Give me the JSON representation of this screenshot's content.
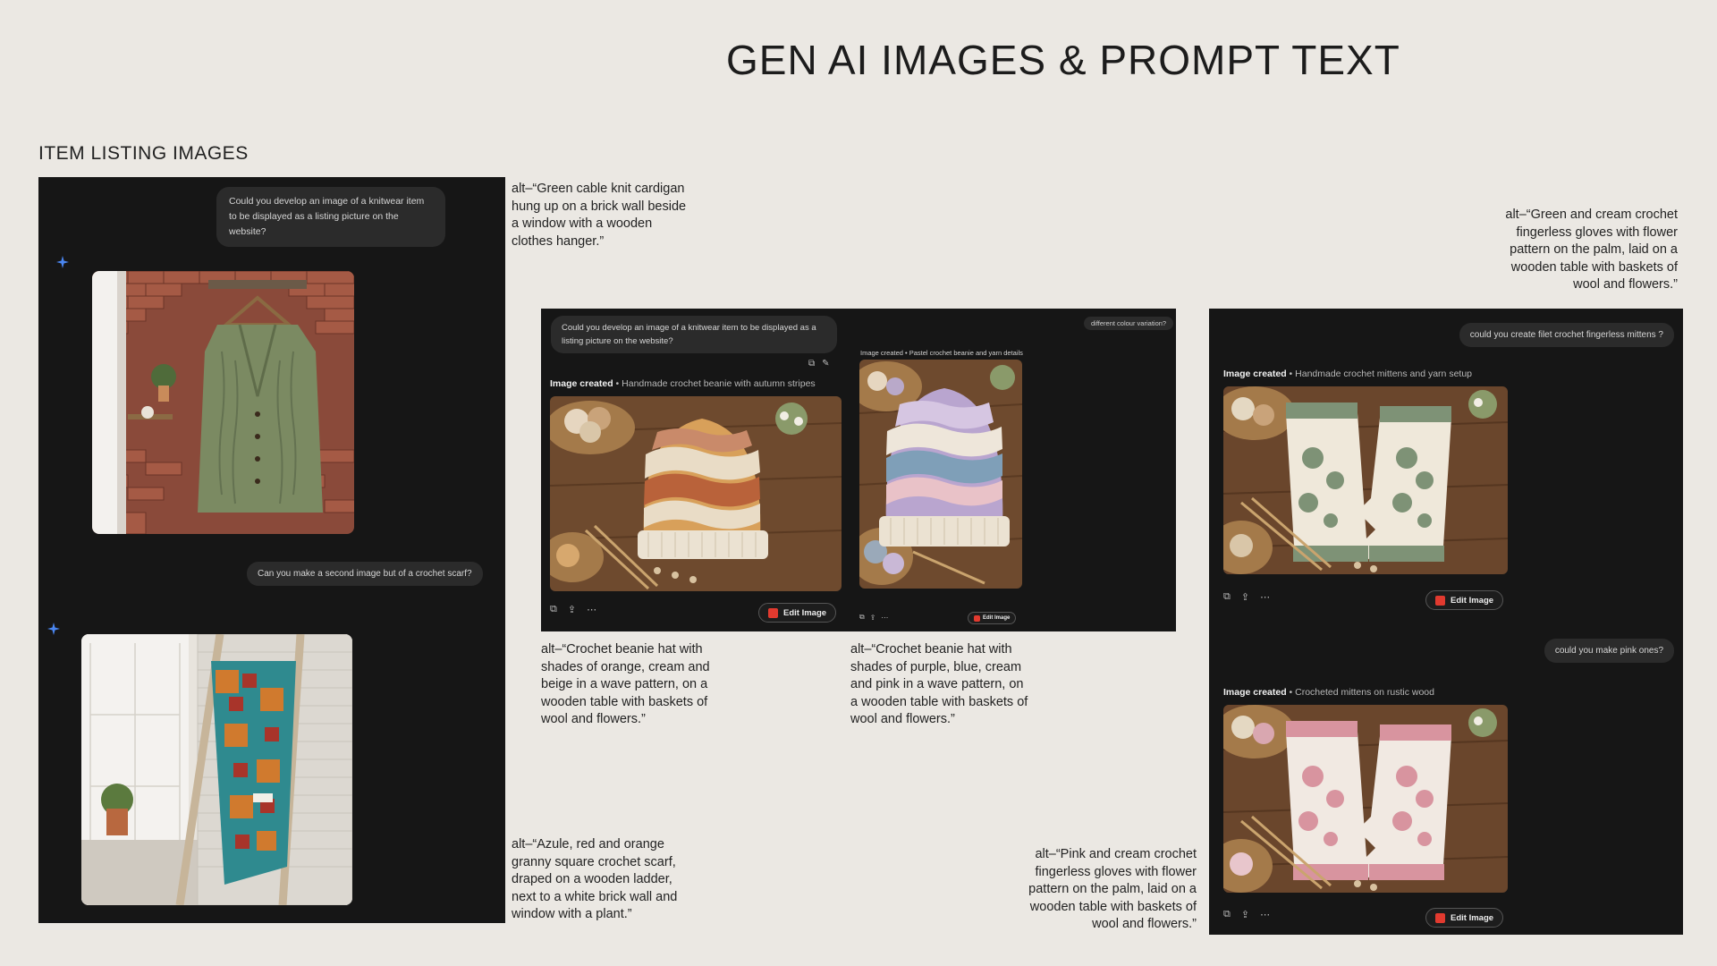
{
  "page": {
    "title": "GEN AI IMAGES & PROMPT TEXT",
    "section_title": "ITEM LISTING IMAGES"
  },
  "left_panel": {
    "prompt_1": "Could you develop an image of a knitwear item to be displayed as a listing picture on the website?",
    "prompt_2": "Can you make a second image but of a crochet scarf?",
    "image_1_icon": "cardigan-image",
    "image_2_icon": "scarf-image"
  },
  "middle_panel": {
    "prompt": "Could you develop an image of a knitwear item to be displayed as a listing picture on the website?",
    "variation_prompt": "different colour variation?",
    "caption_1_label": "Image created",
    "caption_1_text": "Handmade crochet beanie with autumn stripes",
    "caption_2_text": "Image created • Pastel crochet beanie and yarn details",
    "edit_label": "Edit Image",
    "edit_label_small": "Edit Image"
  },
  "right_panel": {
    "prompt_1": "could you create filet crochet fingerless mittens ?",
    "caption_1_label": "Image created",
    "caption_1_text": "Handmade crochet mittens and yarn setup",
    "prompt_2": "could you make pink ones?",
    "caption_2_label": "Image created",
    "caption_2_text": "Crocheted mittens on rustic wood",
    "edit_label": "Edit Image"
  },
  "alt_texts": {
    "cardigan": "alt–“Green cable knit cardigan hung up on a brick wall beside a window with a wooden clothes hanger.”",
    "scarf": "alt–“Azule, red and orange granny square crochet scarf, draped on a wooden ladder, next to a white brick wall and window with a plant.”",
    "beanie_orange": "alt–“Crochet beanie hat with shades of orange, cream and beige in a wave pattern, on a wooden table with baskets of wool and flowers.”",
    "beanie_purple": "alt–“Crochet beanie hat with shades of purple, blue, cream and pink in a wave pattern, on a wooden table with baskets of wool and flowers.”",
    "mittens_green": "alt–“Green and cream crochet fingerless gloves with flower pattern on the palm, laid on a wooden table with baskets of wool and flowers.”",
    "mittens_pink": "alt–“Pink and cream crochet fingerless gloves with flower pattern on the palm, laid on a wooden table with baskets of wool and flowers.”"
  },
  "colors": {
    "background": "#ebe8e3",
    "panel": "#161616",
    "spark": "#4a86f0",
    "edit_icon": "#e23a2f"
  }
}
